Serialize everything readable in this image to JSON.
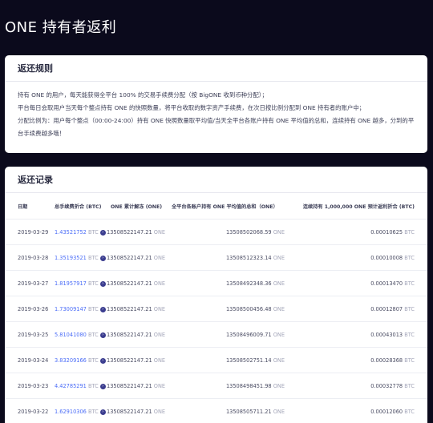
{
  "page": {
    "title": "ONE 持有者返利"
  },
  "rules": {
    "title": "返还规则",
    "lines": [
      "持有 ONE 的用户，每天能获得全平台 100% 的交易手续费分配（按 BigONE 收到币种分配）；",
      "平台每日会取用户当天每个整点持有 ONE 的快照数量，将平台收取的数字资产手续费，在次日按比例分配到 ONE 持有者的账户中；",
      "分配比例为：用户每个整点（00:00-24:00）持有 ONE 快照数量取平均值/当天全平台各账户持有 ONE 平均值的总和，连续持有 ONE 越多，分到的平台手续费越多哦！"
    ]
  },
  "records": {
    "title": "返还记录",
    "columns": {
      "date": "日期",
      "reward": "总手续费折合 (BTC)",
      "held": "ONE 累计解冻 (ONE)",
      "avg": "全平台各账户持有 ONE 平均值的总和（ONE）",
      "est": "连续持有 1,000,000 ONE 预计返利折合 (BTC)"
    },
    "rows": [
      {
        "date": "2019-03-29",
        "reward": "1.43521752",
        "reward_unit": "BTC",
        "held": "13508522147.21",
        "held_unit": "ONE",
        "avg": "13508502068.59",
        "avg_unit": "ONE",
        "est": "0.00010625",
        "est_unit": "BTC"
      },
      {
        "date": "2019-03-28",
        "reward": "1.35193521",
        "reward_unit": "BTC",
        "held": "13508522147.21",
        "held_unit": "ONE",
        "avg": "13508512323.14",
        "avg_unit": "ONE",
        "est": "0.00010008",
        "est_unit": "BTC"
      },
      {
        "date": "2019-03-27",
        "reward": "1.81957917",
        "reward_unit": "BTC",
        "held": "13508522147.21",
        "held_unit": "ONE",
        "avg": "13508492348.36",
        "avg_unit": "ONE",
        "est": "0.00013470",
        "est_unit": "BTC"
      },
      {
        "date": "2019-03-26",
        "reward": "1.73009147",
        "reward_unit": "BTC",
        "held": "13508522147.21",
        "held_unit": "ONE",
        "avg": "13508500456.48",
        "avg_unit": "ONE",
        "est": "0.00012807",
        "est_unit": "BTC"
      },
      {
        "date": "2019-03-25",
        "reward": "5.81041080",
        "reward_unit": "BTC",
        "held": "13508522147.21",
        "held_unit": "ONE",
        "avg": "13508496009.71",
        "avg_unit": "ONE",
        "est": "0.00043013",
        "est_unit": "BTC"
      },
      {
        "date": "2019-03-24",
        "reward": "3.83209166",
        "reward_unit": "BTC",
        "held": "13508522147.21",
        "held_unit": "ONE",
        "avg": "13508502751.14",
        "avg_unit": "ONE",
        "est": "0.00028368",
        "est_unit": "BTC"
      },
      {
        "date": "2019-03-23",
        "reward": "4.42785291",
        "reward_unit": "BTC",
        "held": "13508522147.21",
        "held_unit": "ONE",
        "avg": "13508498451.98",
        "avg_unit": "ONE",
        "est": "0.00032778",
        "est_unit": "BTC"
      },
      {
        "date": "2019-03-22",
        "reward": "1.62910306",
        "reward_unit": "BTC",
        "held": "13508522147.21",
        "held_unit": "ONE",
        "avg": "13508505711.21",
        "avg_unit": "ONE",
        "est": "0.00012060",
        "est_unit": "BTC"
      }
    ]
  }
}
